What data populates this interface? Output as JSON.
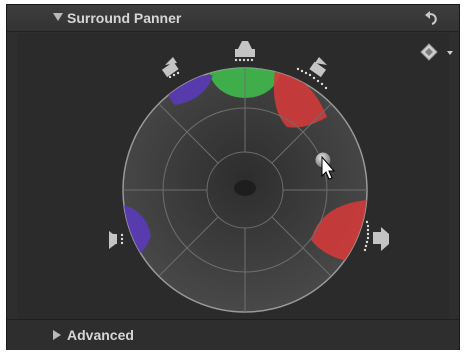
{
  "header": {
    "title": "Surround Panner"
  },
  "footer": {
    "advanced_label": "Advanced"
  },
  "colors": {
    "panel_bg": "#2e2e2e",
    "center_channel": "#3fb94a",
    "front_right_channel": "#d23a3a",
    "surround_right_channel": "#d23a3a",
    "front_left_channel": "#5a3bb8",
    "surround_left_channel": "#5a3bb8"
  },
  "icons": [
    "disclosure-triangle-icon",
    "reset-arrow-icon",
    "keyframe-diamond-icon",
    "dropdown-chevron-icon",
    "speaker-icon",
    "puck-handle",
    "mouse-cursor-icon"
  ]
}
